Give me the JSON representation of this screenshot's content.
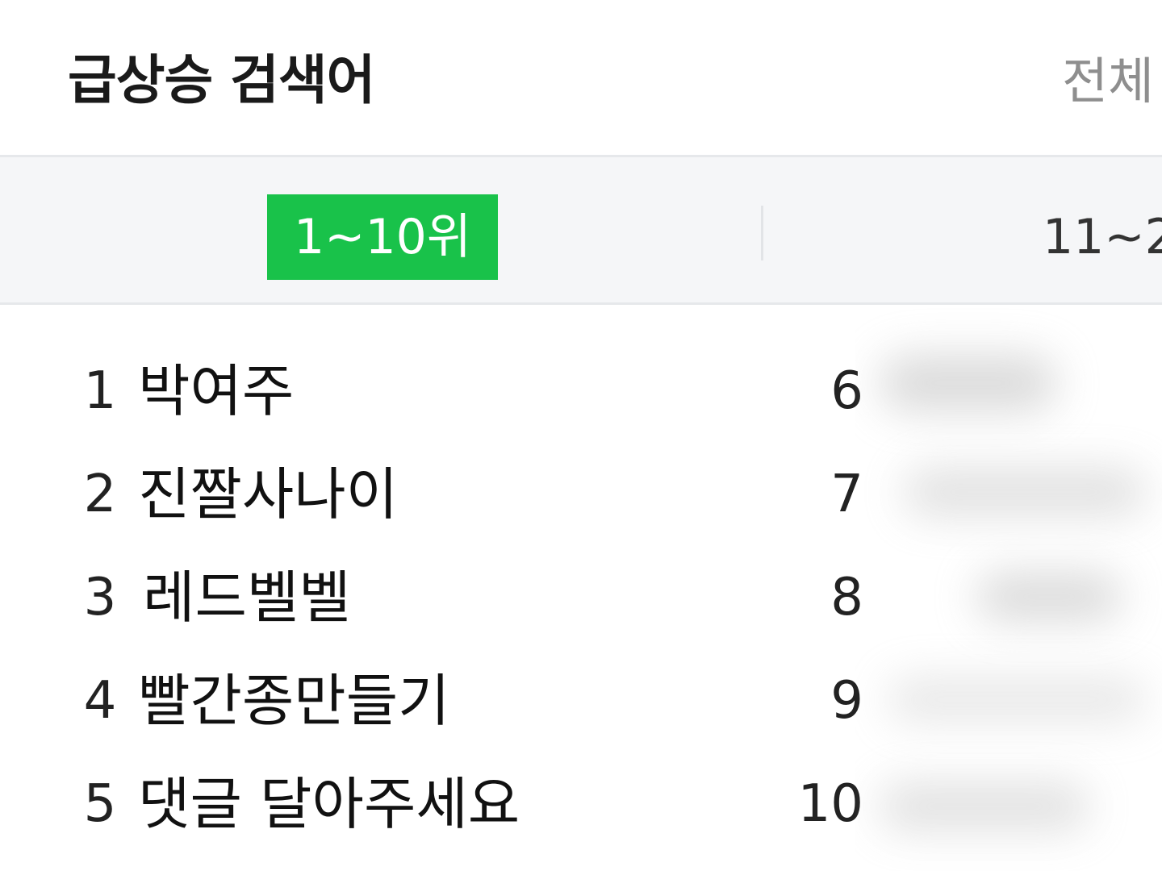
{
  "header": {
    "title": "급상승 검색어",
    "filter_label": "전체"
  },
  "tabs": [
    {
      "label": "1~10위",
      "active": true
    },
    {
      "label": "11~2",
      "active": false
    }
  ],
  "keywords_left": [
    {
      "rank": "1",
      "keyword": "박여주"
    },
    {
      "rank": "2",
      "keyword": "진짤사나이"
    },
    {
      "rank": "3",
      "keyword": "레드벨벨"
    },
    {
      "rank": "4",
      "keyword": "빨간종만들기"
    },
    {
      "rank": "5",
      "keyword": "댓글 달아주세요"
    }
  ],
  "keywords_right": [
    {
      "rank": "6"
    },
    {
      "rank": "7"
    },
    {
      "rank": "8"
    },
    {
      "rank": "9"
    },
    {
      "rank": "10"
    }
  ],
  "colors": {
    "accent_green": "#19c24a",
    "tab_bar_bg": "#f5f6f8",
    "muted_text": "#8e8e8e"
  }
}
